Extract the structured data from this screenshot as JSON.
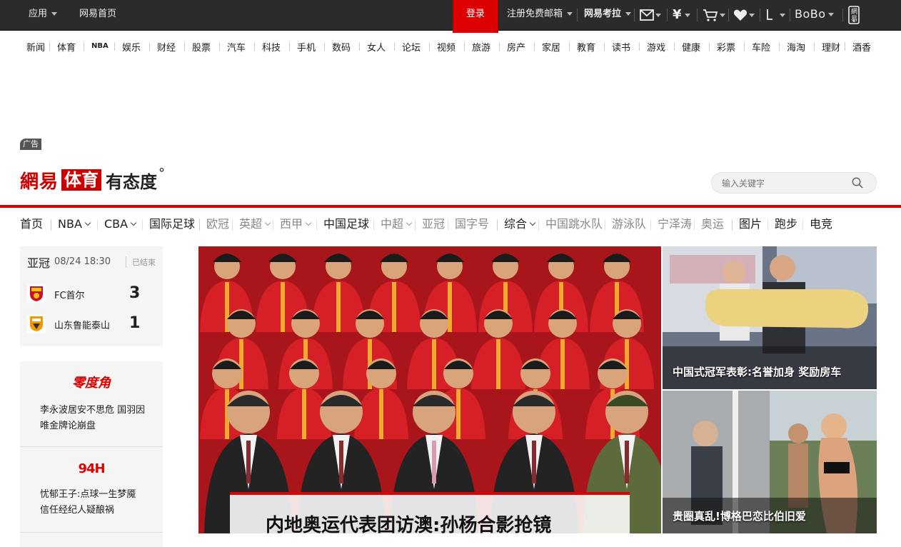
{
  "topbar": {
    "apps": "应用",
    "home": "网易首页",
    "login": "登录",
    "register": "注册免费邮箱",
    "koala": "网易考拉",
    "bobo": "BoBo",
    "mobile_label": "網易"
  },
  "channels": [
    "新闻",
    "体育",
    "NBA",
    "娱乐",
    "财经",
    "股票",
    "汽车",
    "科技",
    "手机",
    "数码",
    "女人",
    "论坛",
    "视频",
    "旅游",
    "房产",
    "家居",
    "教育",
    "读书",
    "游戏",
    "健康",
    "彩票",
    "车险",
    "海淘",
    "理财",
    "酒香"
  ],
  "ad_tag": "广告",
  "logo": {
    "brand": "網易",
    "section": "体育",
    "slogan": "有态度",
    "degree": "°"
  },
  "search": {
    "placeholder": "输入关键字"
  },
  "subnav": [
    {
      "label": "首页",
      "dark": true,
      "arrow": false
    },
    {
      "label": "NBA",
      "dark": true,
      "arrow": true
    },
    {
      "label": "CBA",
      "dark": true,
      "arrow": true
    },
    {
      "label": "国际足球",
      "dark": true,
      "arrow": false
    },
    {
      "label": "欧冠",
      "dark": false,
      "arrow": false
    },
    {
      "label": "英超",
      "dark": false,
      "arrow": true
    },
    {
      "label": "西甲",
      "dark": false,
      "arrow": true
    },
    {
      "label": "中国足球",
      "dark": true,
      "arrow": false
    },
    {
      "label": "中超",
      "dark": false,
      "arrow": true
    },
    {
      "label": "亚冠",
      "dark": false,
      "arrow": false
    },
    {
      "label": "国字号",
      "dark": false,
      "arrow": false
    },
    {
      "label": "综合",
      "dark": true,
      "arrow": true
    },
    {
      "label": "中国跳水队",
      "dark": false,
      "arrow": false
    },
    {
      "label": "游泳队",
      "dark": false,
      "arrow": false
    },
    {
      "label": "宁泽涛",
      "dark": false,
      "arrow": false
    },
    {
      "label": "奥运",
      "dark": false,
      "arrow": false
    },
    {
      "label": "图片",
      "dark": true,
      "arrow": false
    },
    {
      "label": "跑步",
      "dark": true,
      "arrow": false
    },
    {
      "label": "电竞",
      "dark": true,
      "arrow": false
    }
  ],
  "match": {
    "league": "亚冠",
    "time": "08/24 18:30",
    "status": "已结束",
    "home": {
      "name": "FC首尔",
      "score": "3"
    },
    "away": {
      "name": "山东鲁能泰山",
      "score": "1"
    }
  },
  "columns": [
    {
      "logo": "零度角",
      "text": "李永波居安不思危 国羽因唯金牌论崩盘"
    },
    {
      "logo": "94H",
      "text": "忧郁王子:点球一生梦魇 信任经纪人疑酿祸"
    }
  ],
  "hero": {
    "caption": "内地奥运代表团访澳:孙杨合影抢镜"
  },
  "side": [
    {
      "caption": "中国式冠军表彰:名誉加身 奖励房车"
    },
    {
      "caption": "贵圈真乱!博格巴恋比伯旧爱"
    }
  ],
  "colors": {
    "accent": "#dd0000",
    "topbar": "#2b2b2b"
  }
}
